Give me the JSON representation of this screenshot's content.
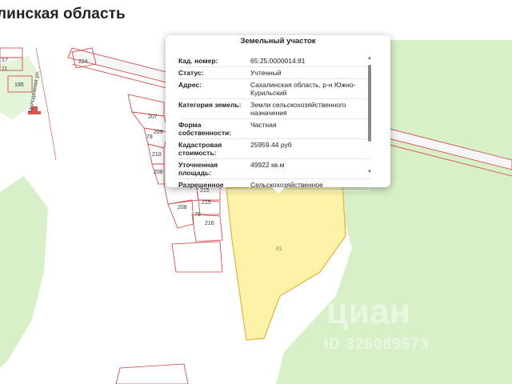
{
  "header": {
    "title": "линская область"
  },
  "popup": {
    "title": "Земельный участок",
    "rows": [
      {
        "label": "Кад. номер:",
        "value": "65:25:0000014:81"
      },
      {
        "label": "Статус:",
        "value": "Учтенный"
      },
      {
        "label": "Адрес:",
        "value": "Сахалинская область, р-н Южно-Курильский"
      },
      {
        "label": "Категория земель:",
        "value": "Земли сельскохозяйственного назначения"
      },
      {
        "label": "Форма собственности:",
        "value": "Частная"
      },
      {
        "label": "Кадастровая стоимость:",
        "value": "25959.44 руб"
      },
      {
        "label": "Уточненная площадь:",
        "value": "49922 кв.м"
      },
      {
        "label": "Разрешенное",
        "value": "Сельскохозяйственное"
      }
    ],
    "scroll_up": "▲",
    "scroll_down": "▼"
  },
  "map": {
    "street": "Молодежная ул.",
    "plot_labels": [
      "17",
      "11",
      "195",
      "224",
      "207",
      "209",
      "78",
      "210",
      "208",
      "215",
      "215",
      "208",
      "78",
      "216"
    ],
    "selected_plot": "81",
    "watermark_logo": "циан",
    "watermark_id": "ID 326089573"
  },
  "colors": {
    "green": "#d8f0c8",
    "plot_fill": "#fcf3a8",
    "plot_stroke": "#e6b23c",
    "boundary": "#d23c3c"
  }
}
